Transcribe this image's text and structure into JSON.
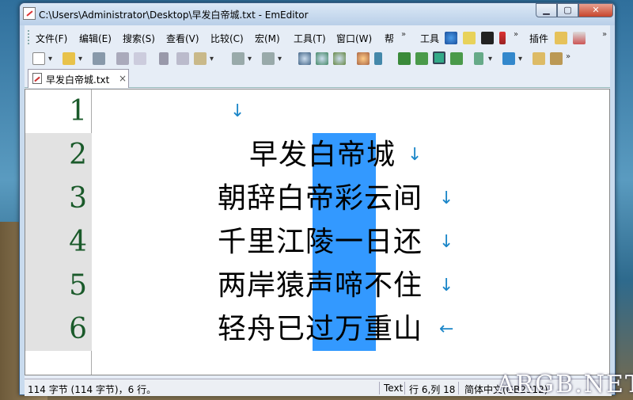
{
  "window": {
    "title": "C:\\Users\\Administrator\\Desktop\\早发白帝城.txt - EmEditor"
  },
  "menu": [
    {
      "label": "文件(F)"
    },
    {
      "label": "编辑(E)"
    },
    {
      "label": "搜索(S)"
    },
    {
      "label": "查看(V)"
    },
    {
      "label": "比较(C)"
    },
    {
      "label": "宏(M)"
    },
    {
      "label": "工具(T)"
    },
    {
      "label": "窗口(W)"
    },
    {
      "label": "帮"
    }
  ],
  "toolbar_labels": {
    "tools": "工具",
    "plugins": "插件"
  },
  "tab": {
    "label": "早发白帝城.txt",
    "close": "×"
  },
  "editor": {
    "line_numbers": [
      "1",
      "2",
      "3",
      "4",
      "5",
      "6"
    ],
    "lines": [
      {
        "text": "",
        "mark": "↓"
      },
      {
        "text": "早发白帝城",
        "mark": "↓"
      },
      {
        "text": "朝辞白帝彩云间",
        "mark": "↓"
      },
      {
        "text": "千里江陵一日还",
        "mark": "↓"
      },
      {
        "text": "两岸猿声啼不住",
        "mark": "↓"
      },
      {
        "text": "轻舟已过万重山",
        "mark": "←"
      }
    ]
  },
  "status": {
    "bytes": "114 字节 (114 字节)，6 行。",
    "mode": "Text",
    "position": "行 6,列 18",
    "encoding": "简体中文(GB2312)"
  },
  "watermark": "ARGB.NET",
  "colors": {
    "selection": "#3399ff",
    "line_mark": "#1b86c8",
    "line_number": "#1a5a2a"
  }
}
